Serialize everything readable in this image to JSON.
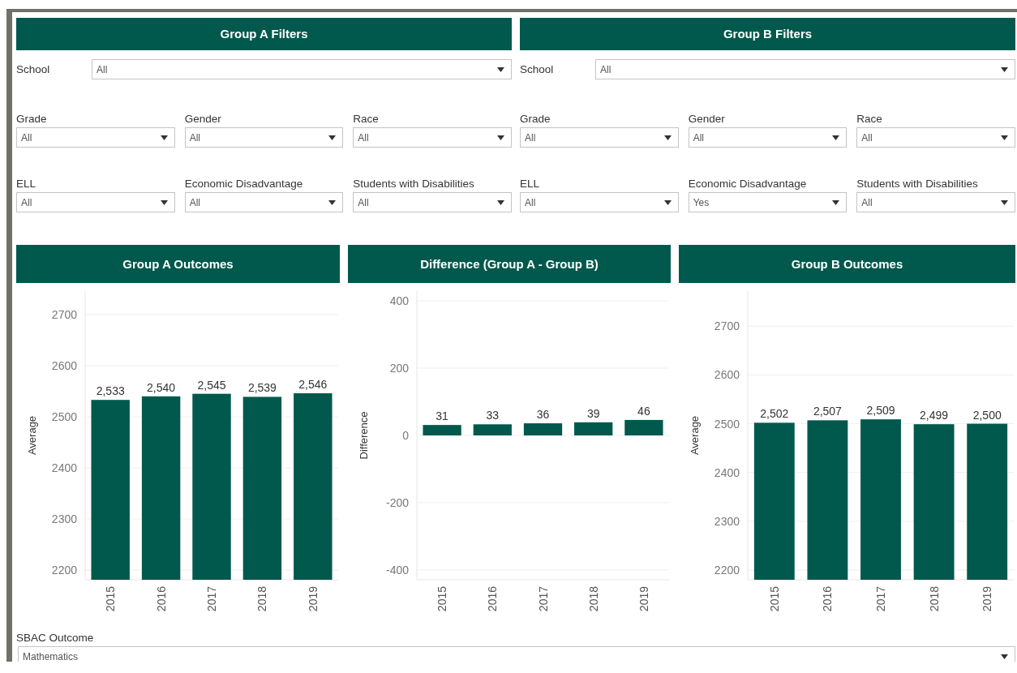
{
  "group_filters": [
    {
      "title": "Group A Filters",
      "school": {
        "label": "School",
        "value": "All"
      },
      "filters": [
        {
          "label": "Grade",
          "value": "All"
        },
        {
          "label": "Gender",
          "value": "All"
        },
        {
          "label": "Race",
          "value": "All"
        },
        {
          "label": "ELL",
          "value": "All"
        },
        {
          "label": "Economic Disadvantage",
          "value": "All"
        },
        {
          "label": "Students with Disabilities",
          "value": "All"
        }
      ]
    },
    {
      "title": "Group B Filters",
      "school": {
        "label": "School",
        "value": "All"
      },
      "filters": [
        {
          "label": "Grade",
          "value": "All"
        },
        {
          "label": "Gender",
          "value": "All"
        },
        {
          "label": "Race",
          "value": "All"
        },
        {
          "label": "ELL",
          "value": "All"
        },
        {
          "label": "Economic Disadvantage",
          "value": "Yes"
        },
        {
          "label": "Students with Disabilities",
          "value": "All"
        }
      ]
    }
  ],
  "outcome_panels": [
    {
      "title": "Group A Outcomes",
      "chart_data": {
        "type": "bar",
        "ylabel": "Average",
        "categories": [
          "2015",
          "2016",
          "2017",
          "2018",
          "2019"
        ],
        "series": [
          {
            "color": "#00594c",
            "values": [
              2533,
              2540,
              2545,
              2539,
              2546
            ]
          }
        ],
        "ylim": [
          2181,
          2746
        ],
        "yticks": [
          2200,
          2300,
          2400,
          2500,
          2600,
          2700
        ],
        "grid": true,
        "value_labels": [
          "2,533",
          "2,540",
          "2,545",
          "2,539",
          "2,546"
        ]
      }
    },
    {
      "title": "Difference (Group A - Group B)",
      "chart_data": {
        "type": "bar",
        "ylabel": "Difference",
        "categories": [
          "2015",
          "2016",
          "2017",
          "2018",
          "2019"
        ],
        "series": [
          {
            "color": "#00594c",
            "values": [
              31,
              33,
              36,
              39,
              46
            ]
          }
        ],
        "ylim": [
          -429,
          429
        ],
        "yticks": [
          -400,
          -200,
          0,
          200,
          400
        ],
        "grid": true,
        "value_labels": [
          "31",
          "33",
          "36",
          "39",
          "46"
        ]
      }
    },
    {
      "title": "Group B Outcomes",
      "chart_data": {
        "type": "bar",
        "ylabel": "Average",
        "categories": [
          "2015",
          "2016",
          "2017",
          "2018",
          "2019"
        ],
        "series": [
          {
            "color": "#00594c",
            "values": [
              2502,
              2507,
              2509,
              2499,
              2500
            ]
          }
        ],
        "ylim": [
          2180,
          2772
        ],
        "yticks": [
          2200,
          2300,
          2400,
          2500,
          2600,
          2700
        ],
        "grid": true,
        "value_labels": [
          "2,502",
          "2,507",
          "2,509",
          "2,499",
          "2,500"
        ]
      }
    }
  ],
  "sbac_outcome": {
    "label": "SBAC Outcome",
    "value": "Mathematics"
  }
}
